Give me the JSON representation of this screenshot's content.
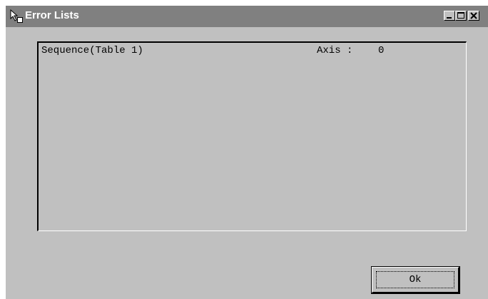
{
  "window": {
    "title": "Error Lists",
    "icon": "cursor-app-icon",
    "controls": [
      "minimize-icon",
      "maximize-icon",
      "close-icon"
    ]
  },
  "error_list": {
    "rows": [
      {
        "sequence": "Sequence(Table 1)",
        "axis_label": "Axis :",
        "axis_value": "0"
      }
    ]
  },
  "buttons": {
    "ok_label": "Ok"
  },
  "colors": {
    "title_bar": "#808080",
    "face": "#c0c0c0",
    "title_text": "#ffffff"
  }
}
